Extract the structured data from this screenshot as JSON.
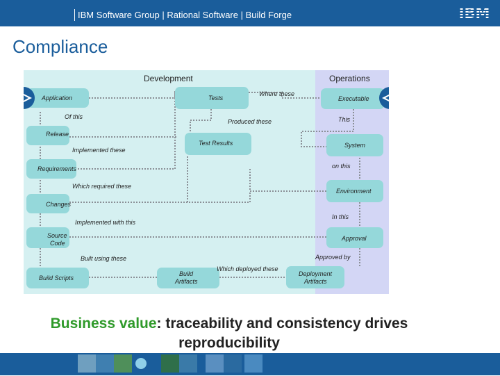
{
  "header": {
    "breadcrumb": "IBM Software Group | Rational Software | Build Forge",
    "logo_text": "IBM"
  },
  "title": "Compliance",
  "diagram": {
    "regions": {
      "left": "Development",
      "right": "Operations"
    },
    "nodes": {
      "application": "Application",
      "tests": "Tests",
      "executable": "Executable",
      "release": "Release",
      "test_results": "Test Results",
      "system": "System",
      "requirements": "Requirements",
      "environment": "Environment",
      "changes": "Changes",
      "source_code_1": "Source",
      "source_code_2": "Code",
      "approval": "Approval",
      "build_scripts": "Build Scripts",
      "build_artifacts_1": "Build",
      "build_artifacts_2": "Artifacts",
      "deployment_artifacts_1": "Deployment",
      "deployment_artifacts_2": "Artifacts"
    },
    "edges": {
      "where_these": "Where these",
      "of_this": "Of this",
      "produced_these": "Produced these",
      "this": "This",
      "implemented_these": "Implemented these",
      "on_this": "on this",
      "which_required_these": "Which required these",
      "in_this": "In this",
      "implemented_with_this": "Implemented with this",
      "approved_by": "Approved by",
      "built_using_these": "Built using these",
      "which_deployed_these": "Which deployed these"
    }
  },
  "business_value": {
    "label": "Business value",
    "text_1": ": traceability and consistency drives",
    "text_2": "reproducibility"
  },
  "colors": {
    "brand_blue": "#1a5d9b",
    "dev_region": "#d5f0f1",
    "ops_region": "#d3d6f5",
    "node_fill": "#95d8da",
    "highlight_green": "#2f9a2a"
  }
}
